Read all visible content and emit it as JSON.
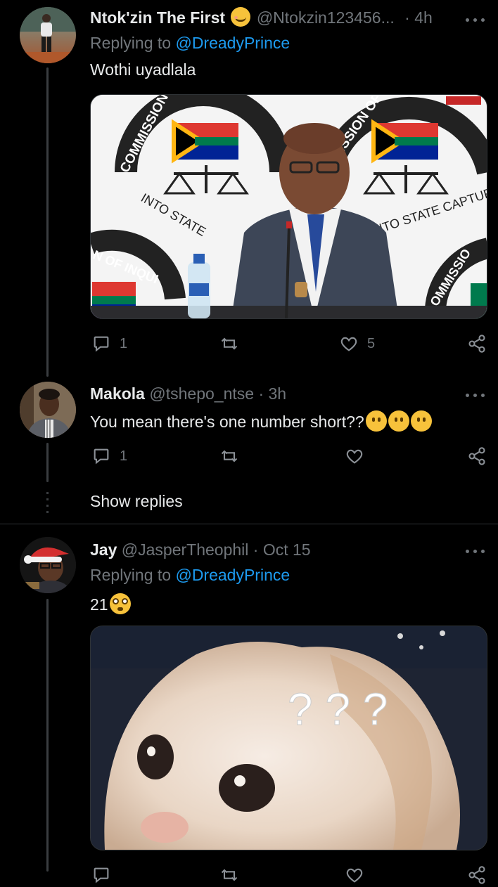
{
  "tweets": [
    {
      "display_name": "Ntok'zin The First",
      "emoji": "😊",
      "handle": "@Ntokzin123456...",
      "sep": "·",
      "time": "4h",
      "replying_prefix": "Replying to",
      "replying_to": "@DreadyPrince",
      "text": "Wothi uyadlala",
      "replies": "1",
      "likes": "5",
      "image": {
        "banner_left": "COMMISSION OF INQUIRY",
        "banner_left_bottom": "INTO STATE",
        "banner_right": "MISSION OF INQUIRY",
        "banner_right_bottom": "INTO STATE CAPTURE",
        "banner_low_left": "N OF INQUI",
        "banner_low_right": "OMMISSIO"
      }
    },
    {
      "display_name": "Makola",
      "handle": "@tshepo_ntse",
      "sep": "·",
      "time": "3h",
      "text": "You mean there's one number short??",
      "emojis": [
        "🤔",
        "🤔",
        "😏"
      ],
      "replies": "1",
      "show_replies": "Show replies"
    },
    {
      "display_name": "Jay",
      "handle": "@JasperTheophil",
      "sep": "·",
      "time": "Oct 15",
      "replying_prefix": "Replying to",
      "replying_to": "@DreadyPrince",
      "text": "21",
      "emoji": "😳",
      "image": {
        "question_marks": "? ? ?"
      }
    }
  ],
  "icons": {
    "reply": "reply-icon",
    "retweet": "retweet-icon",
    "like": "heart-icon",
    "share": "share-icon",
    "more": "more-icon"
  },
  "colors": {
    "background": "#000000",
    "link": "#1d9bf0",
    "muted": "#71767b",
    "text": "#e7e9ea"
  }
}
